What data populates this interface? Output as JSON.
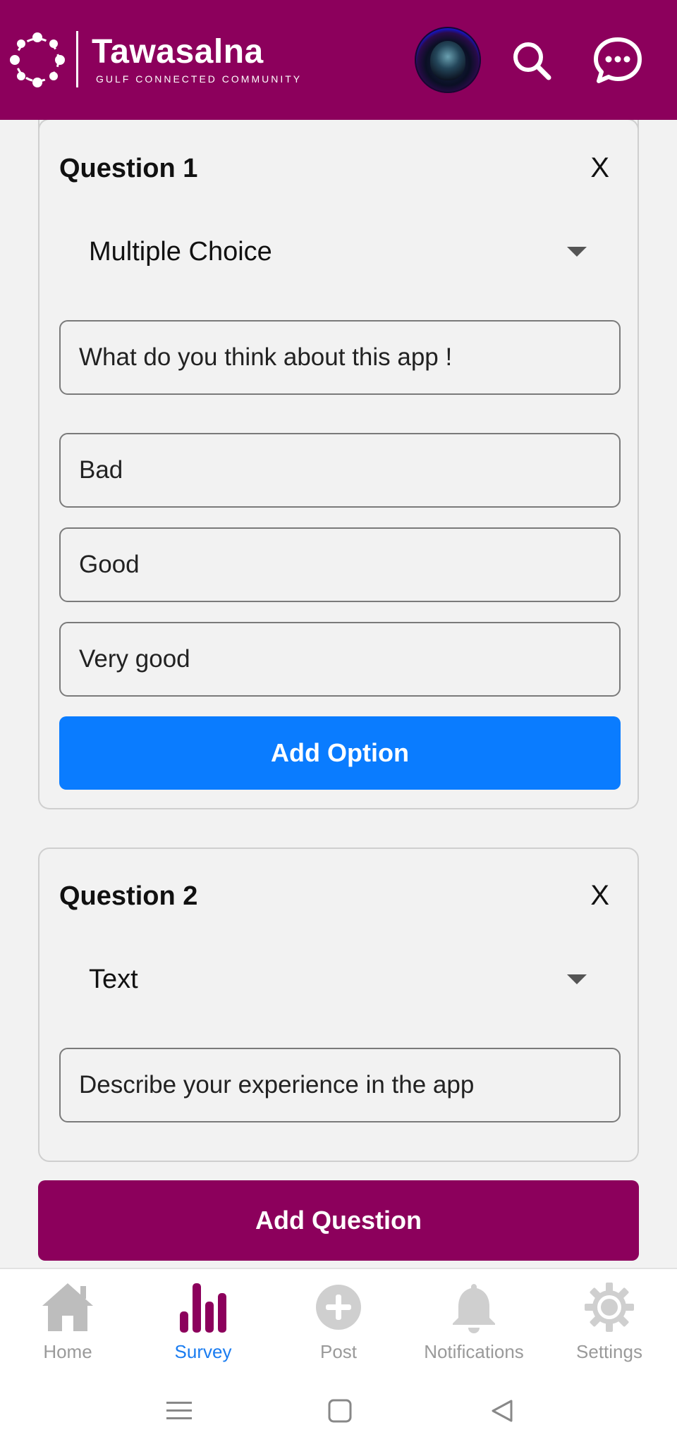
{
  "header": {
    "app_name": "Tawasalna",
    "tagline": "GULF CONNECTED COMMUNITY"
  },
  "colors": {
    "brand": "#8c005c",
    "accent": "#0a7cff",
    "active_tab": "#1a7cf0",
    "inactive_tab": "#9a9a9a"
  },
  "questions": [
    {
      "title": "Question 1",
      "close": "X",
      "type": "Multiple Choice",
      "text": "What do you think about this app !",
      "options": [
        "Bad",
        "Good",
        "Very good"
      ],
      "add_option_label": "Add Option"
    },
    {
      "title": "Question 2",
      "close": "X",
      "type": "Text",
      "text": "Describe your experience in the app"
    }
  ],
  "add_question_label": "Add Question",
  "tabs": [
    {
      "label": "Home",
      "icon": "home-icon"
    },
    {
      "label": "Survey",
      "icon": "bar-chart-icon",
      "active": true
    },
    {
      "label": "Post",
      "icon": "plus-circle-icon"
    },
    {
      "label": "Notifications",
      "icon": "bell-icon"
    },
    {
      "label": "Settings",
      "icon": "gear-icon"
    }
  ]
}
